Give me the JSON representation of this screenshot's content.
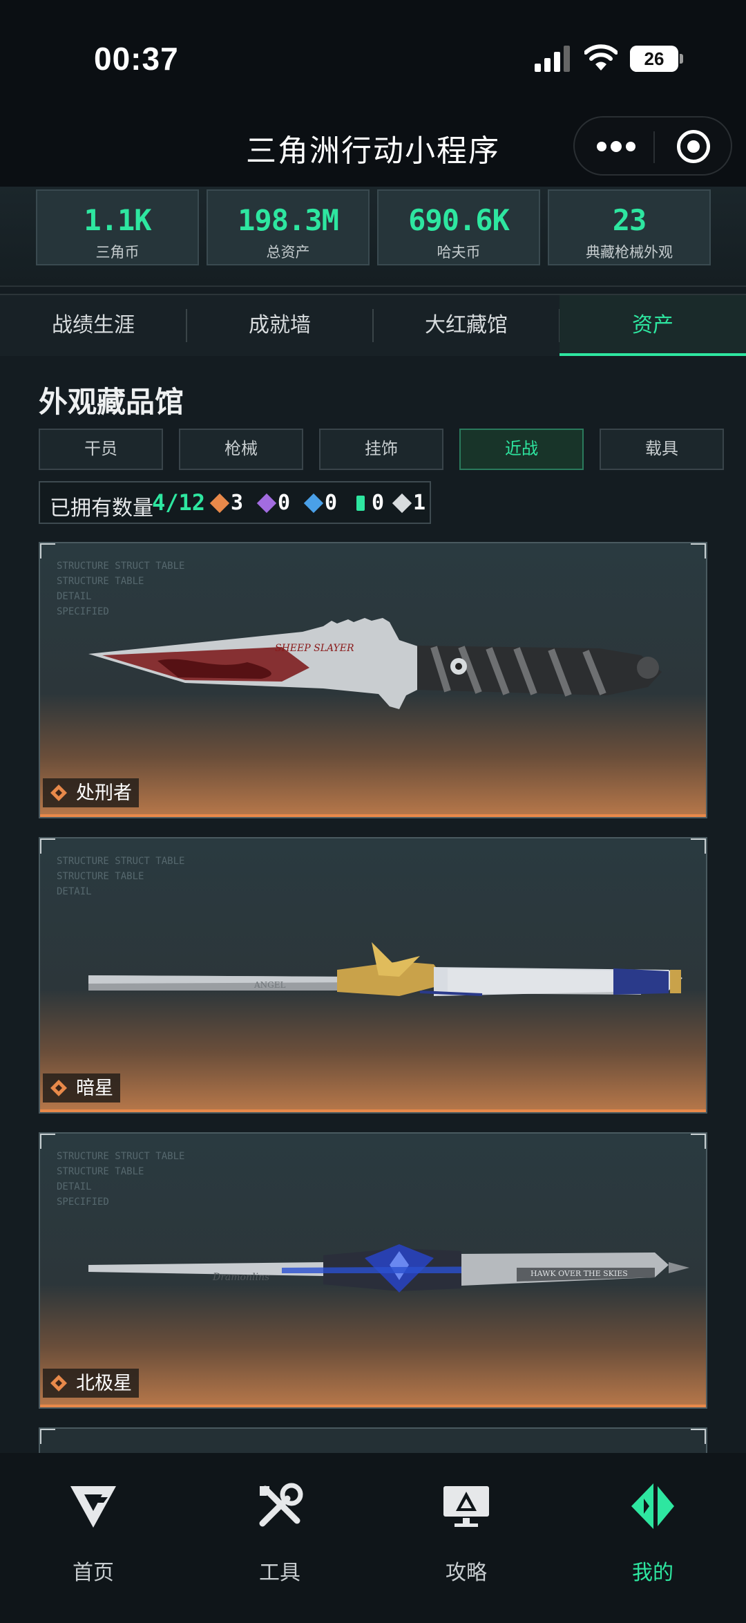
{
  "status_bar": {
    "time": "00:37",
    "battery": "26",
    "battery_level": 0.26
  },
  "header": {
    "title": "三角洲行动小程序"
  },
  "stats": [
    {
      "value": "1.1K",
      "label": "三角币"
    },
    {
      "value": "198.3M",
      "label": "总资产"
    },
    {
      "value": "690.6K",
      "label": "哈夫币"
    },
    {
      "value": "23",
      "label": "典藏枪械外观"
    }
  ],
  "tabs": [
    {
      "label": "战绩生涯"
    },
    {
      "label": "成就墙"
    },
    {
      "label": "大红藏馆"
    },
    {
      "label": "资产"
    }
  ],
  "section": {
    "title": "外观藏品馆",
    "categories": [
      {
        "label": "干员"
      },
      {
        "label": "枪械"
      },
      {
        "label": "挂饰"
      },
      {
        "label": "近战"
      },
      {
        "label": "载具"
      }
    ],
    "owned_label": "已拥有数量",
    "owned_count": "4/12",
    "rarity_counts": [
      {
        "count": "3",
        "color": "#e8894a"
      },
      {
        "count": "0",
        "color": "#a26ce0"
      },
      {
        "count": "0",
        "color": "#4aa0e8"
      },
      {
        "count": "0",
        "color": "#2ee6a0"
      },
      {
        "count": "1",
        "color": "#d8dcde"
      }
    ]
  },
  "items": [
    {
      "name": "处刑者",
      "engraving": "SHEEP SLAYER"
    },
    {
      "name": "暗星",
      "engraving": "ANGEL"
    },
    {
      "name": "北极星",
      "engraving": "Dramonlins",
      "engraving2": "HAWK OVER THE SKIES"
    }
  ],
  "card_bg_text": [
    "STRUCTURE STRUCT TABLE",
    "STRUCTURE TABLE",
    "DETAIL",
    "SPECIFIED"
  ],
  "bottom_nav": [
    {
      "label": "首页"
    },
    {
      "label": "工具"
    },
    {
      "label": "攻略"
    },
    {
      "label": "我的"
    }
  ],
  "colors": {
    "accent": "#2ee6a0",
    "gold_rarity": "#e8894a"
  }
}
